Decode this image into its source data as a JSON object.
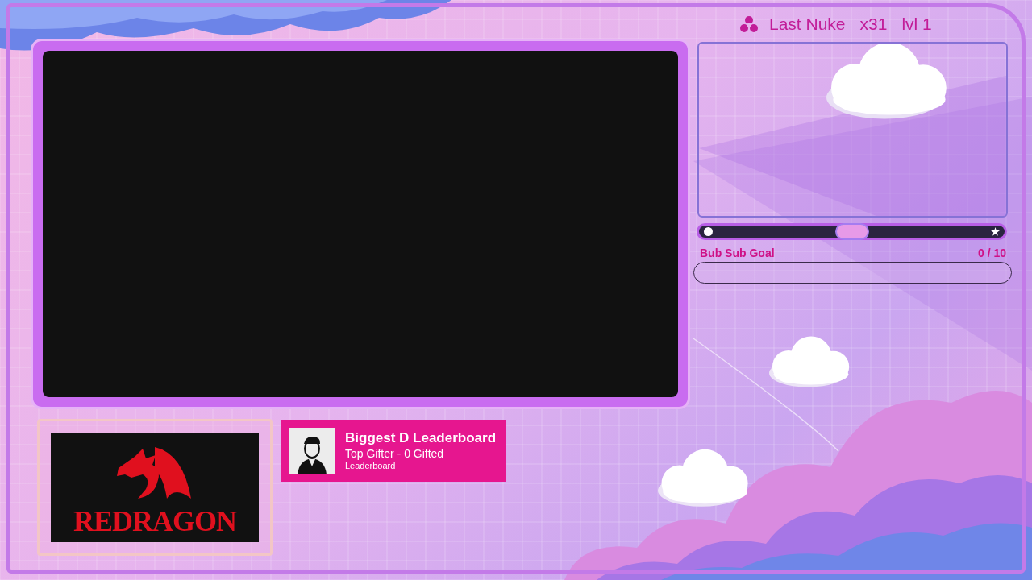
{
  "nuke": {
    "label": "Last Nuke",
    "count": "x31",
    "level": "lvl 1"
  },
  "goal_meter": {
    "level": 0.5
  },
  "sub_goal": {
    "title": "Bub Sub Goal",
    "progress": "0 / 10",
    "level": 0
  },
  "sponsor": {
    "logo_text": "REDRAGON"
  },
  "leaderboard": {
    "title": "Biggest D Leaderboard",
    "subtitle": "Top Gifter - 0 Gifted",
    "caption": "Leaderboard"
  }
}
